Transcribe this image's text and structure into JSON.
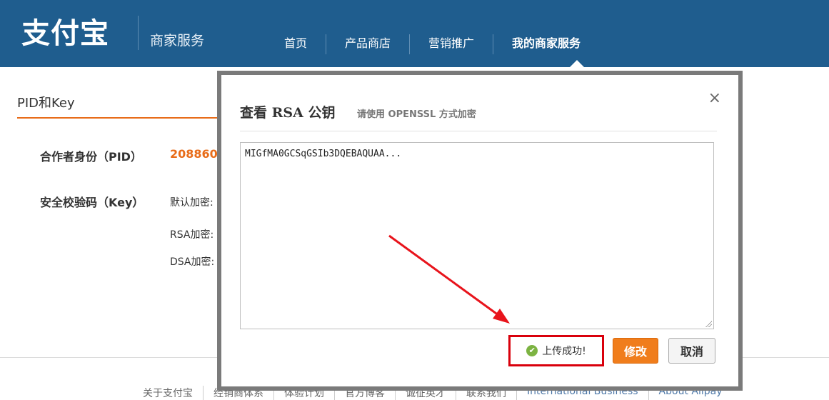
{
  "header": {
    "logo": "支付宝",
    "subtitle": "商家服务",
    "nav": [
      "首页",
      "产品商店",
      "营销推广",
      "我的商家服务"
    ]
  },
  "page": {
    "section_title": "PID和Key",
    "pid_label": "合作者身份（PID）",
    "pid_value": "208860",
    "key_label": "安全校验码（Key）",
    "default_label": "默认加密:",
    "rsa_label": "RSA加密:",
    "dsa_label": "DSA加密:"
  },
  "footer": {
    "links": [
      "关于支付宝",
      "经销商体系",
      "体验计划",
      "官方博客",
      "诚征英才",
      "联系我们",
      "International Business",
      "About Alipay"
    ]
  },
  "modal": {
    "title": "查看 RSA 公钥",
    "hint": "请使用 OPENSSL 方式加密",
    "close": "×",
    "key_text": "MIGfMA0GCSqGSIb3DQEBAQUAA...",
    "success_text": "上传成功!",
    "success_icon": "check-circle-icon",
    "modify_label": "修改",
    "cancel_label": "取消"
  },
  "colors": {
    "header_bg": "#1f5d8e",
    "accent": "#e86c19",
    "modify_button": "#f07d1c",
    "highlight_box": "#d9000c",
    "arrow": "#e8141c"
  }
}
